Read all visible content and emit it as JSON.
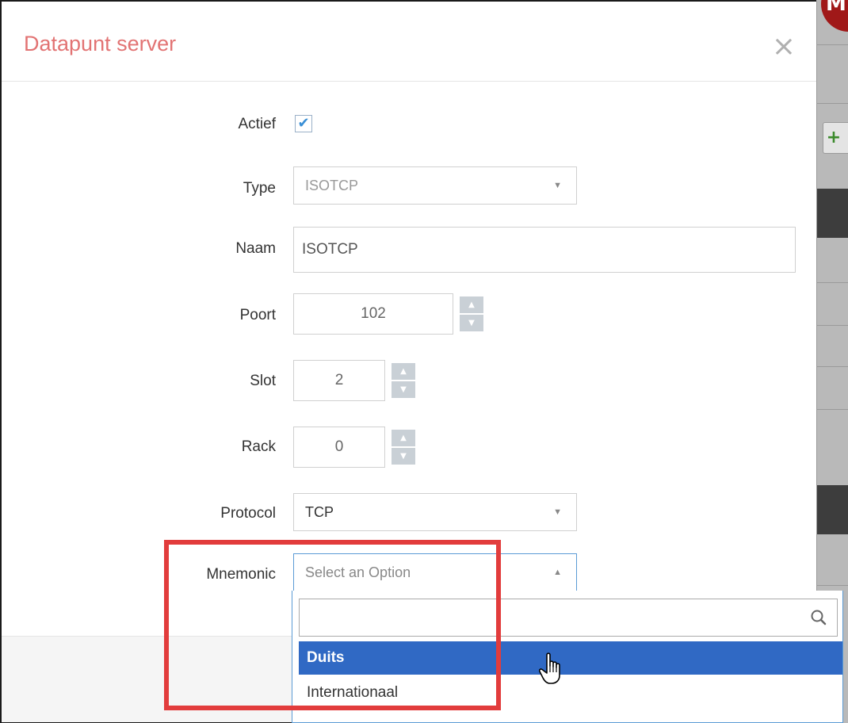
{
  "background_app": {
    "avatar_text": "M",
    "add_button": "+"
  },
  "modal": {
    "title": "Datapunt server",
    "close_icon": "×"
  },
  "form": {
    "actief": {
      "label": "Actief",
      "checked": true,
      "check_glyph": "✔"
    },
    "type": {
      "label": "Type",
      "value": "ISOTCP",
      "disabled": true
    },
    "naam": {
      "label": "Naam",
      "value": "ISOTCP"
    },
    "poort": {
      "label": "Poort",
      "value": "102"
    },
    "slot": {
      "label": "Slot",
      "value": "2"
    },
    "rack": {
      "label": "Rack",
      "value": "0"
    },
    "protocol": {
      "label": "Protocol",
      "value": "TCP"
    },
    "mnemonic": {
      "label": "Mnemonic",
      "placeholder": "Select an Option",
      "open": true,
      "search_value": "",
      "options": [
        "Duits",
        "Internationaal"
      ],
      "highlighted_option": "Duits"
    }
  },
  "colors": {
    "title": "#e27373",
    "highlight": "#3069c4",
    "annotation": "#e23c3c",
    "checkbox_mark": "#3a8fd6"
  },
  "icons": {
    "close": "close-icon",
    "checkmark": "checkmark-icon",
    "chevron": "chevron-down-icon",
    "search": "search-icon",
    "cursor": "hand-pointer-cursor"
  }
}
